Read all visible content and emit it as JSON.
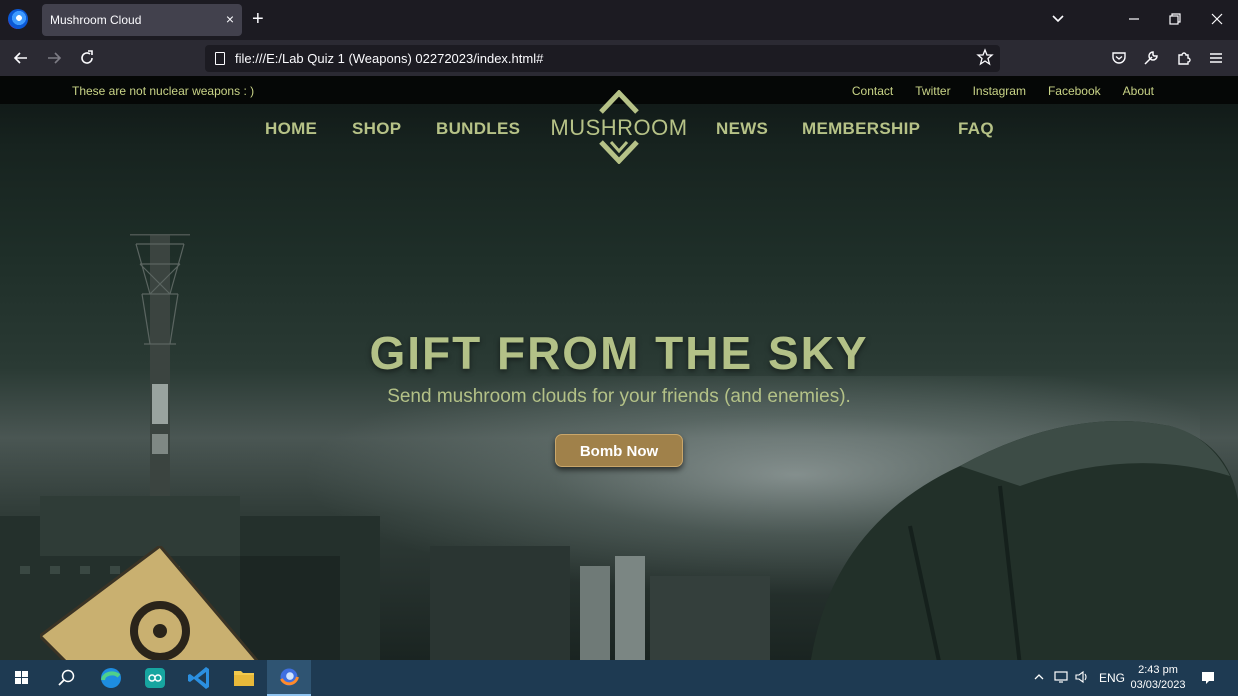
{
  "browser": {
    "tab_title": "Mushroom Cloud",
    "tab_close": "×",
    "new_tab": "+",
    "url": "file:///E:/Lab Quiz 1 (Weapons) 02272023/index.html#",
    "icons": [
      "firefox-icon",
      "back-icon",
      "forward-icon",
      "reload-icon",
      "star-icon",
      "pocket-icon",
      "wrench-icon",
      "extensions-icon",
      "menu-icon"
    ]
  },
  "site": {
    "tagline": "These are not nuclear weapons : )",
    "top_links": [
      "Contact",
      "Twitter",
      "Instagram",
      "Facebook",
      "About"
    ],
    "nav": {
      "home": "HOME",
      "shop": "SHOP",
      "bundles": "BUNDLES",
      "logo": "MUSHROOM",
      "news": "NEWS",
      "membership": "MEMBERSHIP",
      "faq": "FAQ"
    },
    "hero": {
      "title": "GIFT FROM THE SKY",
      "subtitle": "Send mushroom clouds for your friends (and enemies).",
      "button": "Bomb Now"
    },
    "colors": {
      "accent": "#b6c287",
      "button": "#a0814a",
      "topbar": "#050706"
    }
  },
  "taskbar": {
    "language": "ENG",
    "time": "2:43 pm",
    "date": "03/03/2023",
    "apps": [
      "start-icon",
      "search-icon",
      "edge-icon",
      "arduino-icon",
      "vscode-icon",
      "file-explorer-icon",
      "firefox-icon"
    ]
  }
}
